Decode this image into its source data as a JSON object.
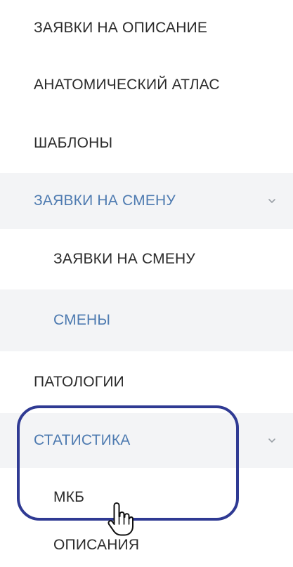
{
  "menu": {
    "items": [
      {
        "label": "ЗАЯВКИ НА ОПИСАНИЕ"
      },
      {
        "label": "АНАТОМИЧЕСКИЙ АТЛАС"
      },
      {
        "label": "ШАБЛОНЫ"
      },
      {
        "label": "ЗАЯВКИ НА СМЕНУ",
        "expanded": true,
        "icon": "chevron-down-icon"
      },
      {
        "label": "ЗАЯВКИ НА СМЕНУ"
      },
      {
        "label": "СМЕНЫ"
      },
      {
        "label": "ПАТОЛОГИИ"
      },
      {
        "label": "СТАТИСТИКА",
        "expanded": true,
        "icon": "chevron-down-icon"
      },
      {
        "label": "МКБ"
      },
      {
        "label": "ОПИСАНИЯ"
      }
    ]
  },
  "colors": {
    "active_text": "#4d7ab0",
    "default_text": "#2b2b2b",
    "shaded_row": "#f3f4f6",
    "highlight_outline": "#2f3a93"
  },
  "cursor": {
    "icon": "hand-pointer-icon"
  }
}
